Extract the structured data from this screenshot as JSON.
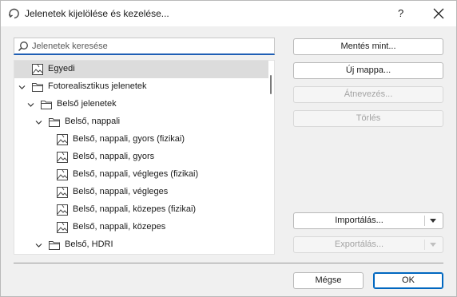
{
  "window": {
    "title": "Jelenetek kijelölése és kezelése...",
    "help_label": "?"
  },
  "search": {
    "placeholder": "Jelenetek keresése",
    "value": ""
  },
  "tree": {
    "items": [
      {
        "label": "Egyedi",
        "icon": "image-icon",
        "expanded": null,
        "selected": true
      },
      {
        "label": "Fotorealisztikus jelenetek",
        "icon": "folder-icon",
        "expanded": true
      },
      {
        "label": "Belső jelenetek",
        "icon": "folder-icon",
        "expanded": true
      },
      {
        "label": "Belső, nappali",
        "icon": "folder-icon",
        "expanded": true
      },
      {
        "label": "Belső, nappali, gyors (fizikai)",
        "icon": "image-icon"
      },
      {
        "label": "Belső, nappali, gyors",
        "icon": "image-icon"
      },
      {
        "label": "Belső, nappali, végleges (fizikai)",
        "icon": "image-icon"
      },
      {
        "label": "Belső, nappali, végleges",
        "icon": "image-icon"
      },
      {
        "label": "Belső, nappali, közepes (fizikai)",
        "icon": "image-icon"
      },
      {
        "label": "Belső, nappali, közepes",
        "icon": "image-icon"
      },
      {
        "label": "Belső, HDRI",
        "icon": "folder-icon",
        "expanded": true
      }
    ]
  },
  "buttons": {
    "save_as": "Mentés mint...",
    "new_folder": "Új mappa...",
    "rename": "Átnevezés...",
    "delete": "Törlés",
    "import": "Importálás...",
    "export": "Exportálás...",
    "cancel": "Mégse",
    "ok": "OK"
  },
  "colors": {
    "selection": "#dcdcdc",
    "accent": "#0067c0",
    "disabled_text": "#a3a3a3"
  }
}
